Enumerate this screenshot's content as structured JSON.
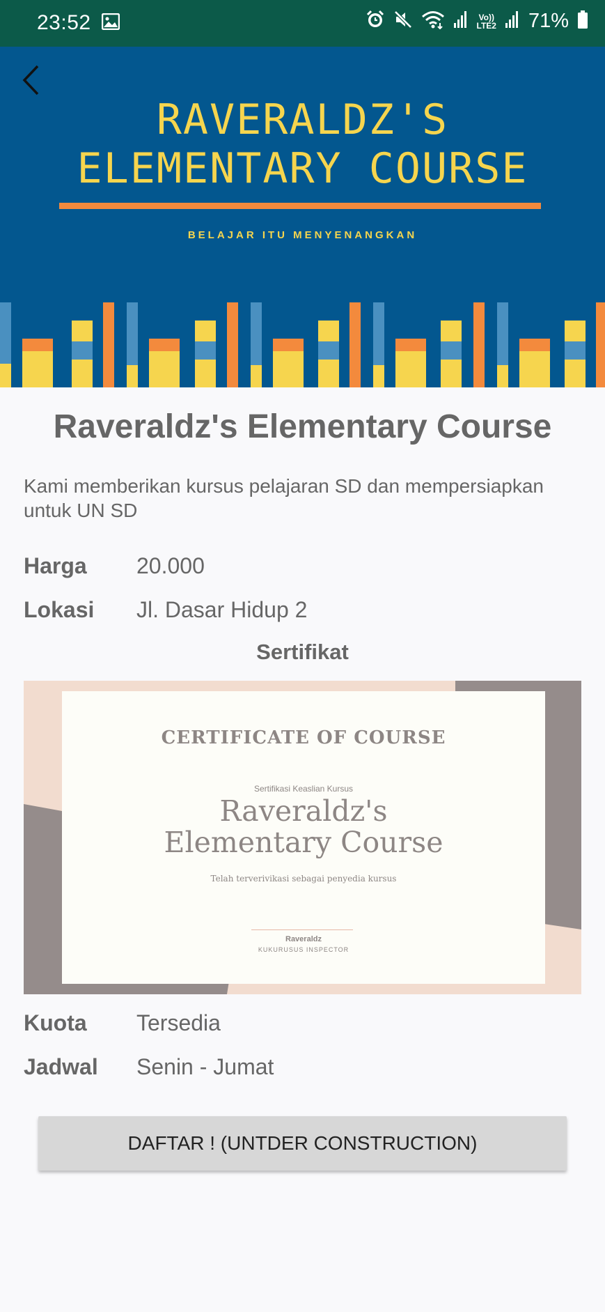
{
  "status_bar": {
    "time": "23:52",
    "battery": "71%",
    "icons": [
      "image-icon",
      "alarm-icon",
      "mute-icon",
      "wifi-icon",
      "signal-icon",
      "volte-icon",
      "signal2-icon",
      "battery-icon"
    ],
    "volte_label_top": "Vo))",
    "volte_label_bottom": "LTE2"
  },
  "banner": {
    "title_line1": "RAVERALDZ'S",
    "title_line2": "ELEMENTARY COURSE",
    "subtitle": "BELAJAR ITU MENYENANGKAN",
    "colors": {
      "background": "#03578f",
      "yellow": "#f6d54e",
      "orange": "#f38a3d",
      "light_blue": "#4a90c0"
    }
  },
  "course": {
    "title": "Raveraldz's Elementary Course",
    "description": "Kami memberikan kursus pelajaran SD dan mempersiapkan untuk UN SD",
    "price_label": "Harga",
    "price": "20.000",
    "location_label": "Lokasi",
    "location": "Jl. Dasar Hidup 2",
    "certificate_label": "Sertifikat",
    "quota_label": "Kuota",
    "quota": "Tersedia",
    "schedule_label": "Jadwal",
    "schedule": "Senin - Jumat"
  },
  "certificate": {
    "heading": "CERTIFICATE OF COURSE",
    "small": "Sertifikasi Keaslian Kursus",
    "name_line1": "Raveraldz's",
    "name_line2": "Elementary Course",
    "verify": "Telah terverivikasi sebagai penyedia kursus",
    "signer": "Raveraldz",
    "role": "KUKURUSUS INSPECTOR"
  },
  "cta": {
    "label": "DAFTAR ! (UNTDER CONSTRUCTION)"
  }
}
